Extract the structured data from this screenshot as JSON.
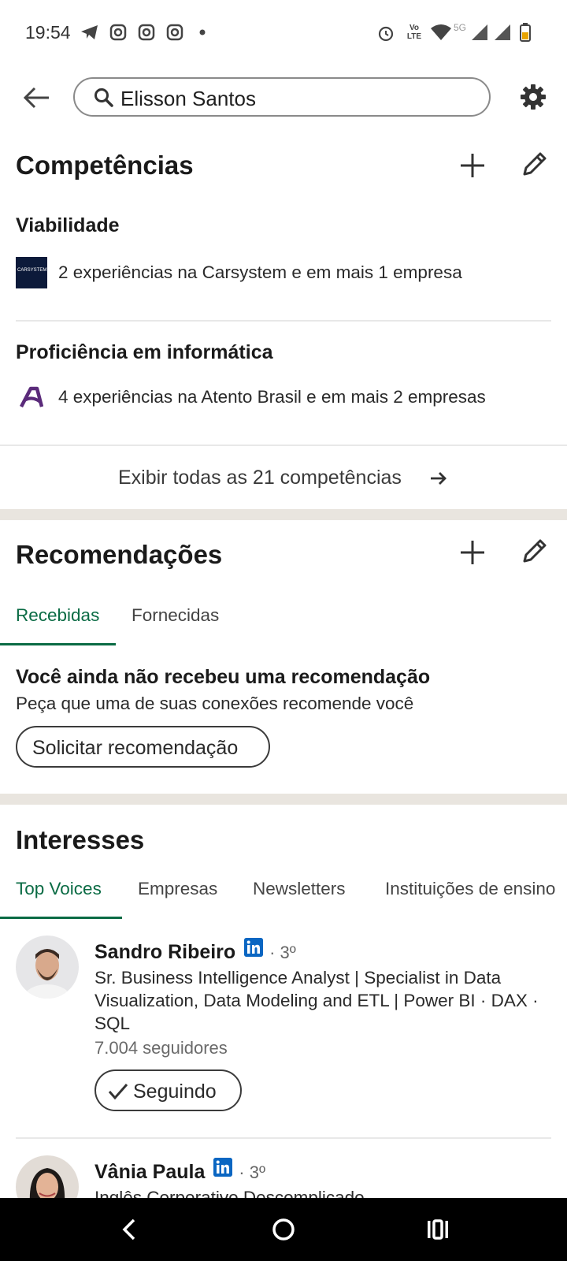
{
  "status_bar": {
    "time": "19:54",
    "network": "5G",
    "volte": "Vo LTE"
  },
  "search": {
    "query": "Elisson Santos"
  },
  "skills": {
    "title": "Competências",
    "items": [
      {
        "name": "Viabilidade",
        "detail": "2 experiências na Carsystem e em mais 1 empresa",
        "logo_text": "CARSYSTEM"
      },
      {
        "name": "Proficiência em informática",
        "detail": "4 experiências na Atento Brasil e em mais 2 empresas"
      }
    ],
    "show_all": "Exibir todas as 21 competências"
  },
  "recommendations": {
    "title": "Recomendações",
    "tabs": [
      "Recebidas",
      "Fornecidas"
    ],
    "empty_title": "Você ainda não recebeu uma recomendação",
    "empty_sub": "Peça que uma de suas conexões recomende você",
    "request_button": "Solicitar recomendação"
  },
  "interests": {
    "title": "Interesses",
    "tabs": [
      "Top Voices",
      "Empresas",
      "Newsletters",
      "Instituições de ensino"
    ],
    "people": [
      {
        "name": "Sandro Ribeiro",
        "degree": "· 3º",
        "headline": "Sr. Business Intelligence Analyst | Specialist in Data Visualization, Data Modeling and ETL | Power BI · DAX · SQL",
        "followers": "7.004 seguidores",
        "follow_label": "Seguindo"
      },
      {
        "name": "Vânia Paula",
        "degree": "· 3º",
        "headline": "Inglês Corporativo Descomplicado"
      }
    ]
  },
  "colors": {
    "accent": "#0a6b44",
    "linkedin": "#0a66c2",
    "band": "#e9e5df"
  }
}
